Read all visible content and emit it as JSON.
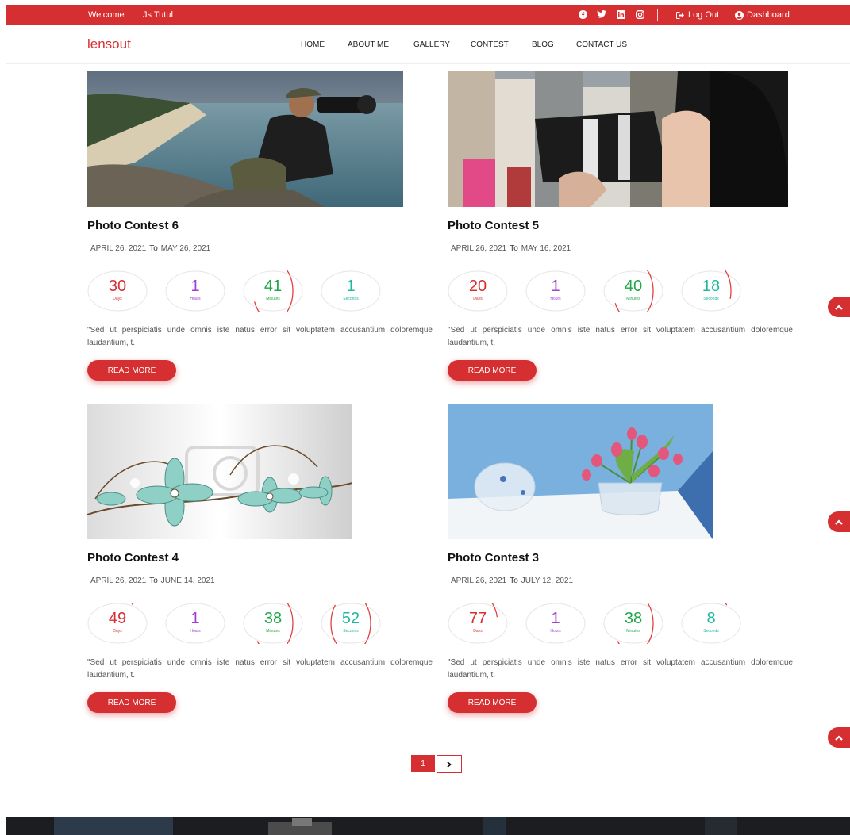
{
  "topbar": {
    "welcome": "Welcome",
    "user": "Js Tutul",
    "social_icons": [
      "facebook-icon",
      "twitter-icon",
      "linkedin-icon",
      "instagram-icon"
    ],
    "logout": "Log Out",
    "dashboard": "Dashboard"
  },
  "nav": {
    "logo": "lensout",
    "items": [
      "HOME",
      "ABOUT ME",
      "GALLERY",
      "CONTEST",
      "BLOG",
      "CONTACT US"
    ]
  },
  "contests": [
    {
      "title": "Photo Contest 6",
      "start": "APRIL 26, 2021",
      "to": "To",
      "end": "MAY 26, 2021",
      "countdown": [
        {
          "value": "30",
          "unit": "Days",
          "fraction": 0.07
        },
        {
          "value": "1",
          "unit": "Hours",
          "fraction": 0.04
        },
        {
          "value": "41",
          "unit": "Minutes",
          "fraction": 0.68
        },
        {
          "value": "1",
          "unit": "Seconds",
          "fraction": 0.02
        }
      ],
      "description": "\"Sed ut perspiciatis unde omnis iste natus error sit voluptatem accusantium doloremque laudantium, t.",
      "button": "READ MORE"
    },
    {
      "title": "Photo Contest 5",
      "start": "APRIL 26, 2021",
      "to": "To",
      "end": "MAY 16, 2021",
      "countdown": [
        {
          "value": "20",
          "unit": "Days",
          "fraction": 0.05
        },
        {
          "value": "1",
          "unit": "Hours",
          "fraction": 0.04
        },
        {
          "value": "40",
          "unit": "Minutes",
          "fraction": 0.67
        },
        {
          "value": "18",
          "unit": "Seconds",
          "fraction": 0.3
        }
      ],
      "description": "\"Sed ut perspiciatis unde omnis iste natus error sit voluptatem accusantium doloremque laudantium, t.",
      "button": "READ MORE"
    },
    {
      "title": "Photo Contest 4",
      "start": "APRIL 26, 2021",
      "to": "To",
      "end": "JUNE 14, 2021",
      "countdown": [
        {
          "value": "49",
          "unit": "Days",
          "fraction": 0.13
        },
        {
          "value": "1",
          "unit": "Hours",
          "fraction": 0.04
        },
        {
          "value": "38",
          "unit": "Minutes",
          "fraction": 0.63
        },
        {
          "value": "52",
          "unit": "Seconds",
          "fraction": 0.87
        }
      ],
      "description": "\"Sed ut perspiciatis unde omnis iste natus error sit voluptatem accusantium doloremque laudantium, t.",
      "button": "READ MORE"
    },
    {
      "title": "Photo Contest 3",
      "start": "APRIL 26, 2021",
      "to": "To",
      "end": "JULY 12, 2021",
      "countdown": [
        {
          "value": "77",
          "unit": "Days",
          "fraction": 0.21
        },
        {
          "value": "1",
          "unit": "Hours",
          "fraction": 0.04
        },
        {
          "value": "38",
          "unit": "Minutes",
          "fraction": 0.63
        },
        {
          "value": "8",
          "unit": "Seconds",
          "fraction": 0.13
        }
      ],
      "description": "\"Sed ut perspiciatis unde omnis iste natus error sit voluptatem accusantium doloremque laudantium, t.",
      "button": "READ MORE"
    }
  ],
  "countdown_colors": {
    "Days": "#d62f31",
    "Hours": "#a23ed0",
    "Minutes": "#1fa84a",
    "Seconds": "#20b89c",
    "ring_track": "#e6e6e6",
    "ring_progress": "#e2403f"
  },
  "scroll_top_icon": "chevron-up-icon",
  "pagination": {
    "current": "1",
    "next_icon": "chevron-right-icon"
  },
  "accent_color": "#d62f31"
}
